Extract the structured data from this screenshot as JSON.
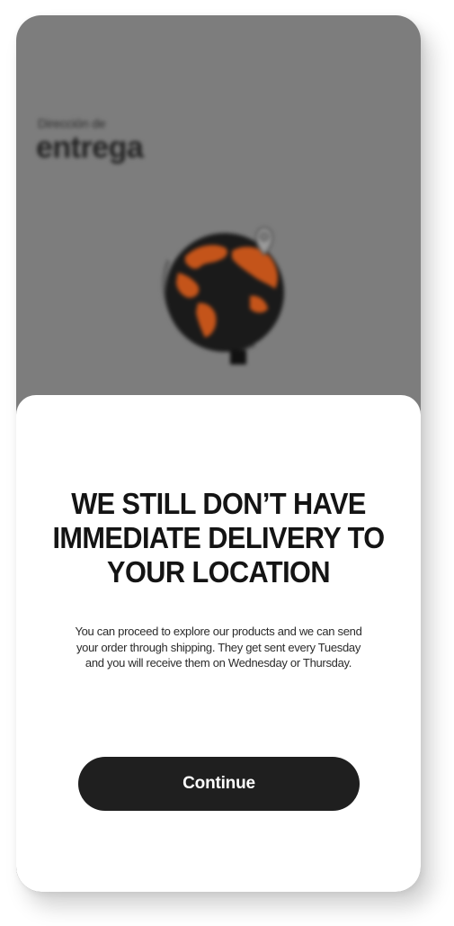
{
  "background": {
    "subtitle": "Dirección de",
    "title": "entrega",
    "illustration": "globe-with-location-pin-icon"
  },
  "modal": {
    "heading": "WE STILL DON’T HAVE IMMEDIATE DELIVERY TO YOUR LOCATION",
    "body": "You can proceed to explore our products and we can send your order through shipping. They get sent every Tuesday and you will receive them on Wednesday or Thursday.",
    "continue_label": "Continue"
  },
  "colors": {
    "overlay": "#7d7d7d",
    "accent": "#c4541a",
    "button": "#1f1f1f",
    "sheet": "#ffffff"
  }
}
